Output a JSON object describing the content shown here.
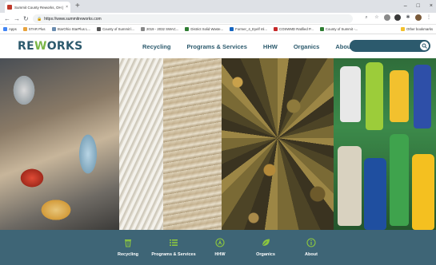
{
  "browser": {
    "tab_title": "Summit County Reworks, OH | S...",
    "tab_close": "×",
    "new_tab": "+",
    "window_controls": [
      "–",
      "□",
      "×"
    ],
    "url": "https://www.summitreworks.com",
    "bookmarks": [
      {
        "label": "Apps",
        "color": "#4285f4"
      },
      {
        "label": "STAR Plus",
        "color": "#e8a33d"
      },
      {
        "label": "StarOhio StarPlus L...",
        "color": "#6a8caf"
      },
      {
        "label": "County of Summit l...",
        "color": "#555555"
      },
      {
        "label": "2019 - 2032 SWAC...",
        "color": "#888888"
      },
      {
        "label": "District Solid Waste...",
        "color": "#2e7d32"
      },
      {
        "label": "Former_4_Eyelf ml...",
        "color": "#1565c0"
      },
      {
        "label": "COSWMD Ratified P...",
        "color": "#c62828"
      },
      {
        "label": "County of Summit -...",
        "color": "#2e7d32"
      }
    ],
    "other_bookmarks": "Other bookmarks"
  },
  "site": {
    "logo": {
      "part1": "RE",
      "part2": "W",
      "part3": "ORKS"
    },
    "nav": [
      "Recycling",
      "Programs & Services",
      "HHW",
      "Organics",
      "About"
    ],
    "search": {
      "value": "",
      "placeholder": ""
    }
  },
  "footer_nav": [
    {
      "label": "Recycling",
      "icon": "recycle-bin-icon"
    },
    {
      "label": "Programs & Services",
      "icon": "list-icon"
    },
    {
      "label": "HHW",
      "icon": "hazard-icon"
    },
    {
      "label": "Organics",
      "icon": "leaf-icon"
    },
    {
      "label": "About",
      "icon": "info-icon"
    }
  ],
  "colors": {
    "brand_dark": "#2c5a6d",
    "brand_green": "#7ab648",
    "footer_bg": "#3e6576"
  }
}
